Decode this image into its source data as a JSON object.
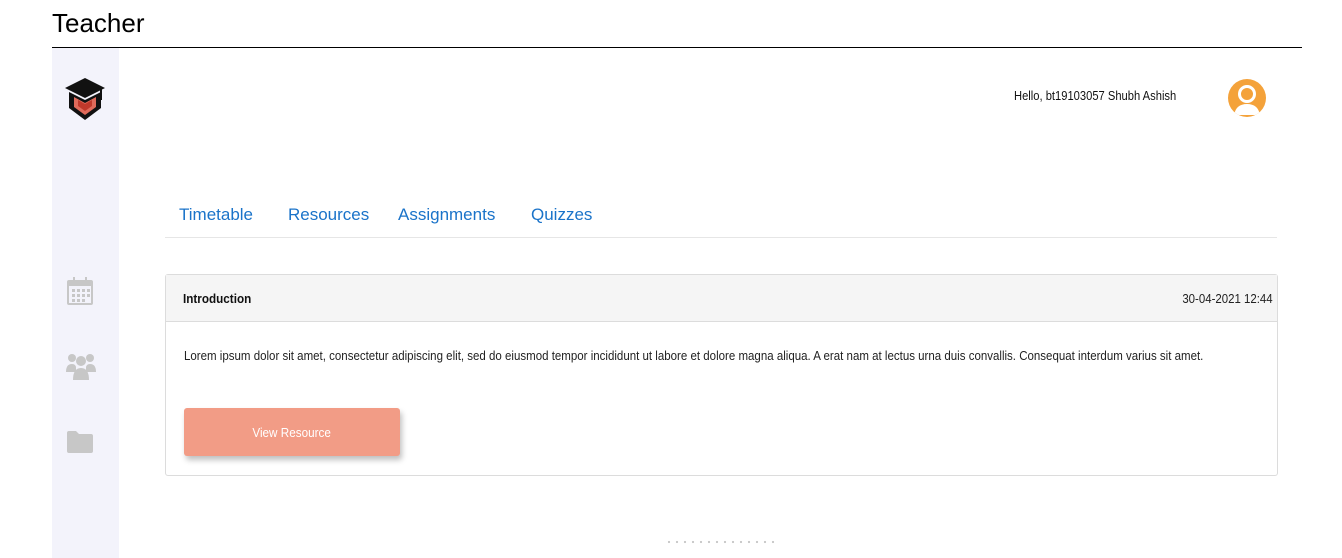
{
  "header": {
    "title": "Teacher"
  },
  "topbar": {
    "greeting": "Hello, bt19103057 Shubh Ashish"
  },
  "sidebar": {
    "items": [
      {
        "icon": "calendar-icon"
      },
      {
        "icon": "group-icon"
      },
      {
        "icon": "folder-icon"
      }
    ]
  },
  "tabs": [
    {
      "label": "Timetable"
    },
    {
      "label": "Resources"
    },
    {
      "label": "Assignments"
    },
    {
      "label": "Quizzes"
    }
  ],
  "resource": {
    "title": "Introduction",
    "date": "30-04-2021 12:44",
    "body": "Lorem ipsum dolor sit amet, consectetur adipiscing elit, sed do eiusmod tempor incididunt ut labore et dolore magna aliqua. A erat nam at lectus urna duis convallis. Consequat interdum varius sit amet.",
    "button_label": "View Resource"
  },
  "colors": {
    "accent": "#1a73c9",
    "button": "#f29c86",
    "avatar": "#f4a23a",
    "sidebar": "#f3f3fb"
  }
}
